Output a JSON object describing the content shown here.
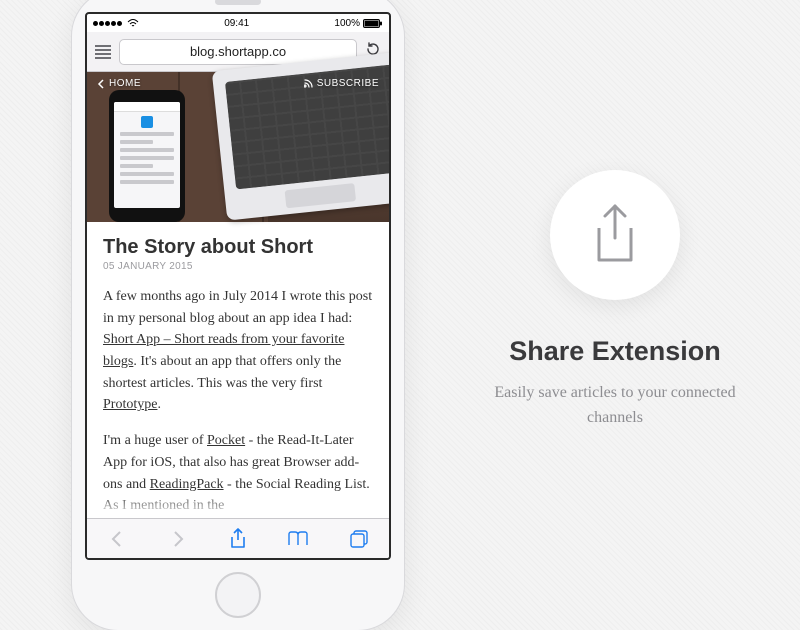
{
  "status": {
    "carrier_dots": 5,
    "time": "09:41",
    "battery": "100%"
  },
  "browser": {
    "url": "blog.shortapp.co",
    "nav": {
      "home": "HOME",
      "subscribe": "SUBSCRIBE"
    }
  },
  "article": {
    "title": "The Story about Short",
    "date": "05 JANUARY 2015",
    "p1_a": "A few months ago in July 2014 I wrote this post in my personal blog about an app idea I had: ",
    "link1": "Short App – Short reads from your favorite blogs",
    "p1_b": ". It's about an app that offers only the shortest articles. This was the very first ",
    "link2": "Prototype",
    "p1_c": ".",
    "p2_a": "I'm a huge user of ",
    "link3": "Pocket",
    "p2_b": " - the Read-It-Later App for iOS, that also has great Browser add-ons and ",
    "link4": "ReadingPack",
    "p2_c": " - the Social Reading List. As I mentioned in the"
  },
  "promo": {
    "title": "Share Extension",
    "subtitle": "Easily save articles to your connected channels"
  }
}
